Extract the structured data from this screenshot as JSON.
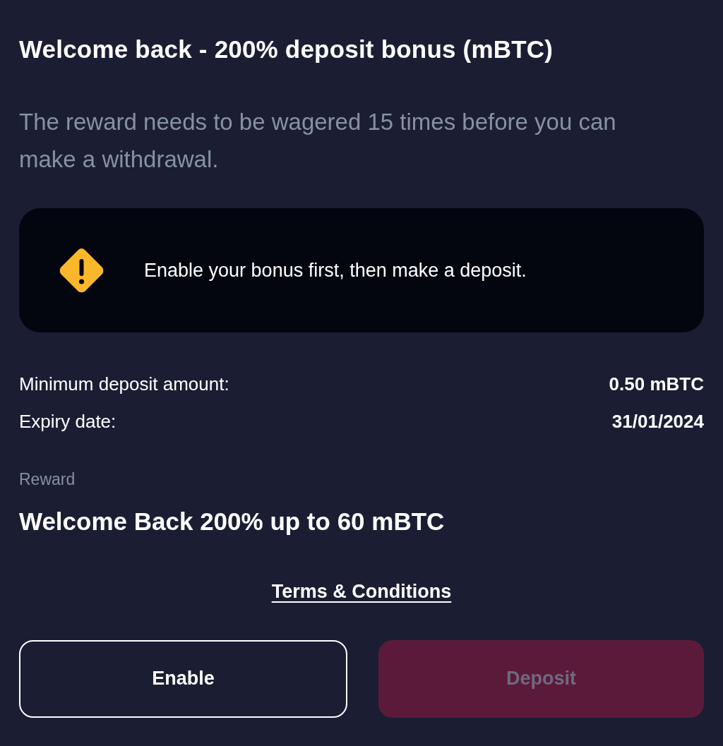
{
  "title": "Welcome back - 200% deposit bonus (mBTC)",
  "description": "The reward needs to be wagered 15 times before you can make a withdrawal.",
  "notice": {
    "kind": "warning",
    "text": "Enable your bonus first, then make a deposit."
  },
  "details": [
    {
      "label": "Minimum deposit amount:",
      "value": "0.50 mBTC"
    },
    {
      "label": "Expiry date:",
      "value": "31/01/2024"
    }
  ],
  "reward": {
    "label": "Reward",
    "value": "Welcome Back 200% up to 60 mBTC"
  },
  "terms_link": "Terms & Conditions",
  "buttons": [
    {
      "label": "Enable",
      "kind": "outline",
      "disabled": false
    },
    {
      "label": "Deposit",
      "kind": "filled",
      "disabled": true
    }
  ]
}
